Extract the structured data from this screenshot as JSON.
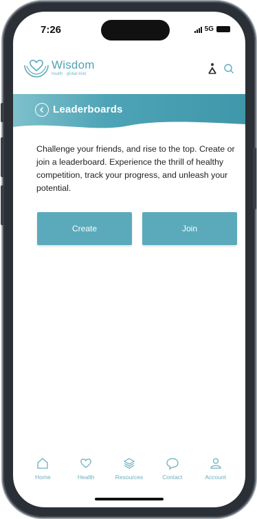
{
  "status": {
    "time": "7:26",
    "network": "5G"
  },
  "brand": {
    "name": "Wisdom",
    "tagline": "health · global kind"
  },
  "page": {
    "title": "Leaderboards"
  },
  "intro_text": "Challenge your friends, and rise to the top. Create or join a leaderboard. Experience the thrill of healthy competition, track your progress, and unleash your potential.",
  "actions": {
    "create_label": "Create",
    "join_label": "Join"
  },
  "nav": {
    "items": [
      {
        "label": "Home",
        "icon": "home-icon"
      },
      {
        "label": "Health",
        "icon": "heart-icon"
      },
      {
        "label": "Resources",
        "icon": "layers-icon"
      },
      {
        "label": "Contact",
        "icon": "chat-icon"
      },
      {
        "label": "Account",
        "icon": "user-icon"
      }
    ]
  },
  "colors": {
    "accent": "#5aaabb",
    "banner": "#4ea4b6",
    "nav": "#6aaebe"
  }
}
